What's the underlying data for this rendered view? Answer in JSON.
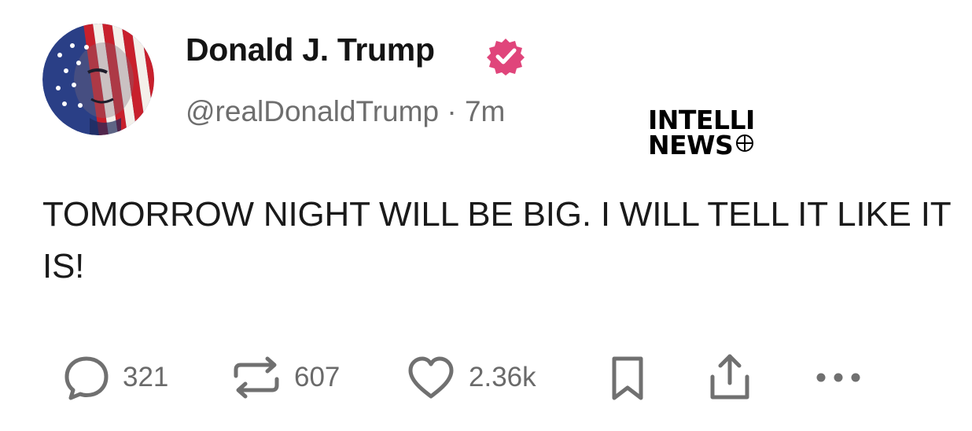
{
  "post": {
    "author": {
      "display_name": "Donald J. Trump",
      "verified_icon": "verified-badge-icon",
      "verified_color": "#e0457b",
      "handle": "@realDonaldTrump",
      "separator": "·",
      "time_ago": "7m",
      "avatar_icon": "profile-avatar-flag-portrait"
    },
    "text": "TOMORROW NIGHT WILL BE BIG. I WILL TELL IT LIKE IT IS!",
    "actions": {
      "reply": {
        "icon": "reply-icon",
        "count": "321"
      },
      "repost": {
        "icon": "repost-icon",
        "count": "607"
      },
      "like": {
        "icon": "heart-icon",
        "count": "2.36k"
      },
      "bookmark": {
        "icon": "bookmark-icon"
      },
      "share": {
        "icon": "share-icon"
      },
      "more": {
        "icon": "more-icon"
      }
    }
  },
  "watermark": {
    "line1": "INTELLI",
    "line2": "NEWS"
  },
  "colors": {
    "text": "#1a1a1a",
    "muted": "#6e6e6e",
    "icon": "#707070",
    "background": "#ffffff"
  }
}
